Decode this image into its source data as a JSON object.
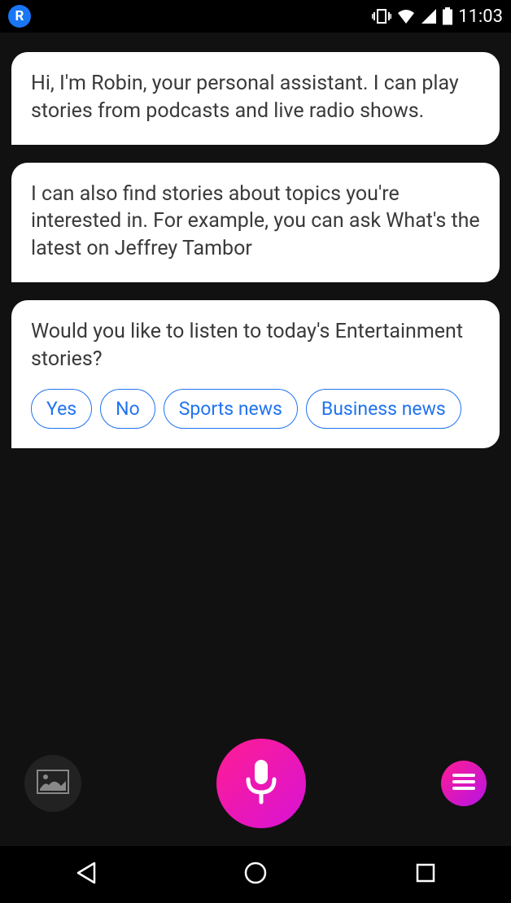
{
  "status_bar": {
    "app_letter": "R",
    "time": "11:03"
  },
  "messages": [
    {
      "text": "Hi, I'm Robin, your personal assistant. I can play stories from podcasts and live radio shows."
    },
    {
      "text": "I can also find stories about topics you're interested in. For example, you can ask What's the latest on Jeffrey Tambor"
    },
    {
      "text": "Would you like to listen to today's Entertainment stories?",
      "options": [
        "Yes",
        "No",
        "Sports news",
        "Business news"
      ]
    }
  ],
  "controls": {
    "map_icon": "map-photo-icon",
    "mic_icon": "microphone-icon",
    "menu_icon": "hamburger-icon"
  },
  "nav": {
    "back": "back",
    "home": "home",
    "recent": "recent"
  }
}
